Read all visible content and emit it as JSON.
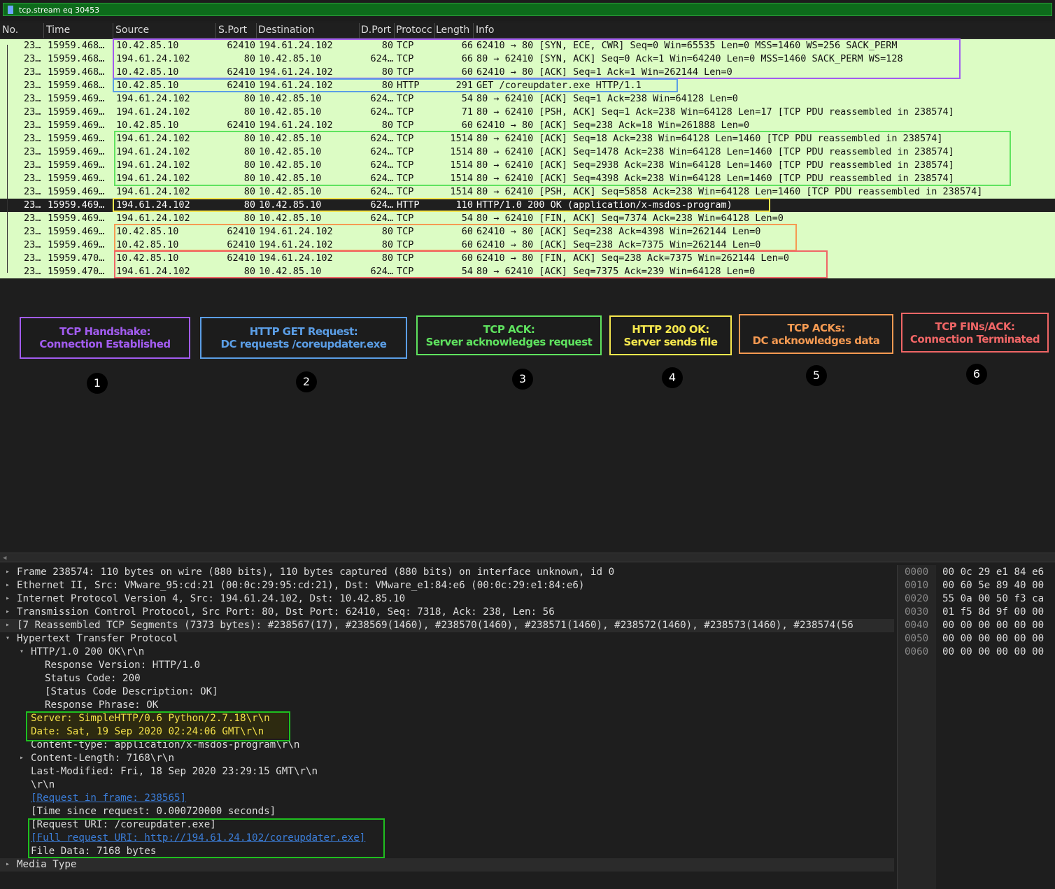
{
  "filter": {
    "text": "tcp.stream eq 30453"
  },
  "columns": [
    "No.",
    "Time",
    "Source",
    "S.Port",
    "Destination",
    "D.Port",
    "Protocc",
    "Length",
    "Info"
  ],
  "packets": [
    {
      "no": "23…",
      "time": "15959.468…",
      "src": "10.42.85.10",
      "sport": "62410",
      "dst": "194.61.24.102",
      "dport": "80",
      "proto": "TCP",
      "len": "66",
      "info": "62410 → 80 [SYN, ECE, CWR] Seq=0 Win=65535 Len=0 MSS=1460 WS=256 SACK_PERM"
    },
    {
      "no": "23…",
      "time": "15959.468…",
      "src": "194.61.24.102",
      "sport": "80",
      "dst": "10.42.85.10",
      "dport": "624…",
      "proto": "TCP",
      "len": "66",
      "info": "80 → 62410 [SYN, ACK] Seq=0 Ack=1 Win=64240 Len=0 MSS=1460 SACK_PERM WS=128"
    },
    {
      "no": "23…",
      "time": "15959.468…",
      "src": "10.42.85.10",
      "sport": "62410",
      "dst": "194.61.24.102",
      "dport": "80",
      "proto": "TCP",
      "len": "60",
      "info": "62410 → 80 [ACK] Seq=1 Ack=1 Win=262144 Len=0"
    },
    {
      "no": "23…",
      "time": "15959.468…",
      "src": "10.42.85.10",
      "sport": "62410",
      "dst": "194.61.24.102",
      "dport": "80",
      "proto": "HTTP",
      "len": "291",
      "info": "GET /coreupdater.exe HTTP/1.1"
    },
    {
      "no": "23…",
      "time": "15959.469…",
      "src": "194.61.24.102",
      "sport": "80",
      "dst": "10.42.85.10",
      "dport": "624…",
      "proto": "TCP",
      "len": "54",
      "info": "80 → 62410 [ACK] Seq=1 Ack=238 Win=64128 Len=0"
    },
    {
      "no": "23…",
      "time": "15959.469…",
      "src": "194.61.24.102",
      "sport": "80",
      "dst": "10.42.85.10",
      "dport": "624…",
      "proto": "TCP",
      "len": "71",
      "info": "80 → 62410 [PSH, ACK] Seq=1 Ack=238 Win=64128 Len=17 [TCP PDU reassembled in 238574]"
    },
    {
      "no": "23…",
      "time": "15959.469…",
      "src": "10.42.85.10",
      "sport": "62410",
      "dst": "194.61.24.102",
      "dport": "80",
      "proto": "TCP",
      "len": "60",
      "info": "62410 → 80 [ACK] Seq=238 Ack=18 Win=261888 Len=0"
    },
    {
      "no": "23…",
      "time": "15959.469…",
      "src": "194.61.24.102",
      "sport": "80",
      "dst": "10.42.85.10",
      "dport": "624…",
      "proto": "TCP",
      "len": "1514",
      "info": "80 → 62410 [ACK] Seq=18 Ack=238 Win=64128 Len=1460 [TCP PDU reassembled in 238574]"
    },
    {
      "no": "23…",
      "time": "15959.469…",
      "src": "194.61.24.102",
      "sport": "80",
      "dst": "10.42.85.10",
      "dport": "624…",
      "proto": "TCP",
      "len": "1514",
      "info": "80 → 62410 [ACK] Seq=1478 Ack=238 Win=64128 Len=1460 [TCP PDU reassembled in 238574]"
    },
    {
      "no": "23…",
      "time": "15959.469…",
      "src": "194.61.24.102",
      "sport": "80",
      "dst": "10.42.85.10",
      "dport": "624…",
      "proto": "TCP",
      "len": "1514",
      "info": "80 → 62410 [ACK] Seq=2938 Ack=238 Win=64128 Len=1460 [TCP PDU reassembled in 238574]"
    },
    {
      "no": "23…",
      "time": "15959.469…",
      "src": "194.61.24.102",
      "sport": "80",
      "dst": "10.42.85.10",
      "dport": "624…",
      "proto": "TCP",
      "len": "1514",
      "info": "80 → 62410 [ACK] Seq=4398 Ack=238 Win=64128 Len=1460 [TCP PDU reassembled in 238574]"
    },
    {
      "no": "23…",
      "time": "15959.469…",
      "src": "194.61.24.102",
      "sport": "80",
      "dst": "10.42.85.10",
      "dport": "624…",
      "proto": "TCP",
      "len": "1514",
      "info": "80 → 62410 [PSH, ACK] Seq=5858 Ack=238 Win=64128 Len=1460 [TCP PDU reassembled in 238574]"
    },
    {
      "no": "23…",
      "time": "15959.469…",
      "src": "194.61.24.102",
      "sport": "80",
      "dst": "10.42.85.10",
      "dport": "624…",
      "proto": "HTTP",
      "len": "110",
      "info": "HTTP/1.0 200 OK  (application/x-msdos-program)"
    },
    {
      "no": "23…",
      "time": "15959.469…",
      "src": "194.61.24.102",
      "sport": "80",
      "dst": "10.42.85.10",
      "dport": "624…",
      "proto": "TCP",
      "len": "54",
      "info": "80 → 62410 [FIN, ACK] Seq=7374 Ack=238 Win=64128 Len=0"
    },
    {
      "no": "23…",
      "time": "15959.469…",
      "src": "10.42.85.10",
      "sport": "62410",
      "dst": "194.61.24.102",
      "dport": "80",
      "proto": "TCP",
      "len": "60",
      "info": "62410 → 80 [ACK] Seq=238 Ack=4398 Win=262144 Len=0"
    },
    {
      "no": "23…",
      "time": "15959.469…",
      "src": "10.42.85.10",
      "sport": "62410",
      "dst": "194.61.24.102",
      "dport": "80",
      "proto": "TCP",
      "len": "60",
      "info": "62410 → 80 [ACK] Seq=238 Ack=7375 Win=262144 Len=0"
    },
    {
      "no": "23…",
      "time": "15959.470…",
      "src": "10.42.85.10",
      "sport": "62410",
      "dst": "194.61.24.102",
      "dport": "80",
      "proto": "TCP",
      "len": "60",
      "info": "62410 → 80 [FIN, ACK] Seq=238 Ack=7375 Win=262144 Len=0"
    },
    {
      "no": "23…",
      "time": "15959.470…",
      "src": "194.61.24.102",
      "sport": "80",
      "dst": "10.42.85.10",
      "dport": "624…",
      "proto": "TCP",
      "len": "54",
      "info": "80 → 62410 [ACK] Seq=7375 Ack=239 Win=64128 Len=0"
    }
  ],
  "selected_row": 12,
  "annotations": [
    {
      "line1": "TCP Handshake:",
      "line2": "Connection Established",
      "color": "#a25cf0",
      "number": "1"
    },
    {
      "line1": "HTTP GET Request:",
      "line2": "DC requests /coreupdater.exe",
      "color": "#5b9ee6",
      "number": "2"
    },
    {
      "line1": "TCP ACK:",
      "line2": "Server acknowledges request",
      "color": "#5fe35f",
      "number": "3"
    },
    {
      "line1": "HTTP 200 OK:",
      "line2": "Server sends file",
      "color": "#f6e84e",
      "number": "4"
    },
    {
      "line1": "TCP ACKs:",
      "line2": "DC acknowledges data",
      "color": "#f59a52",
      "number": "5"
    },
    {
      "line1": "TCP FINs/ACK:",
      "line2": "Connection Terminated",
      "color": "#f06666",
      "number": "6"
    }
  ],
  "details": [
    {
      "text": "Frame 238574: 110 bytes on wire (880 bits), 110 bytes captured (880 bits) on interface unknown, id 0",
      "arrow": "▸"
    },
    {
      "text": "Ethernet II, Src: VMware_95:cd:21 (00:0c:29:95:cd:21), Dst: VMware_e1:84:e6 (00:0c:29:e1:84:e6)",
      "arrow": "▸"
    },
    {
      "text": "Internet Protocol Version 4, Src: 194.61.24.102, Dst: 10.42.85.10",
      "arrow": "▸"
    },
    {
      "text": "Transmission Control Protocol, Src Port: 80, Dst Port: 62410, Seq: 7318, Ack: 238, Len: 56",
      "arrow": "▸"
    },
    {
      "text": "[7 Reassembled TCP Segments (7373 bytes): #238567(17), #238569(1460), #238570(1460), #238571(1460), #238572(1460), #238573(1460), #238574(56",
      "arrow": "▸"
    },
    {
      "text": "Hypertext Transfer Protocol",
      "arrow": "▾"
    },
    {
      "text": "HTTP/1.0 200 OK\\r\\n",
      "arrow": "▾"
    },
    {
      "text": "Response Version: HTTP/1.0",
      "arrow": ""
    },
    {
      "text": "Status Code: 200",
      "arrow": ""
    },
    {
      "text": "[Status Code Description: OK]",
      "arrow": ""
    },
    {
      "text": "Response Phrase: OK",
      "arrow": ""
    },
    {
      "text": "Server: SimpleHTTP/0.6 Python/2.7.18\\r\\n",
      "arrow": ""
    },
    {
      "text": "Date: Sat, 19 Sep 2020 02:24:06 GMT\\r\\n",
      "arrow": ""
    },
    {
      "text": "Content-type: application/x-msdos-program\\r\\n",
      "arrow": ""
    },
    {
      "text": "Content-Length: 7168\\r\\n",
      "arrow": "▸"
    },
    {
      "text": "Last-Modified: Fri, 18 Sep 2020 23:29:15 GMT\\r\\n",
      "arrow": ""
    },
    {
      "text": "\\r\\n",
      "arrow": ""
    },
    {
      "text": "[Request in frame: 238565]",
      "arrow": ""
    },
    {
      "text": "[Time since request: 0.000720000 seconds]",
      "arrow": ""
    },
    {
      "text": "[Request URI: /coreupdater.exe]",
      "arrow": ""
    },
    {
      "text": "[Full request URI: http://194.61.24.102/coreupdater.exe]",
      "arrow": ""
    },
    {
      "text": "File Data: 7168 bytes",
      "arrow": ""
    },
    {
      "text": "Media Type",
      "arrow": "▸"
    }
  ],
  "hex": {
    "offsets": [
      "0000",
      "0010",
      "0020",
      "0030",
      "0040",
      "0050",
      "0060"
    ],
    "bytes": [
      "00 0c 29 e1 84 e6",
      "00 60 5e 89 40 00",
      "55 0a 00 50 f3 ca",
      "01 f5 8d 9f 00 00",
      "00 00 00 00 00 00",
      "00 00 00 00 00 00",
      "00 00 00 00 00 00"
    ]
  }
}
